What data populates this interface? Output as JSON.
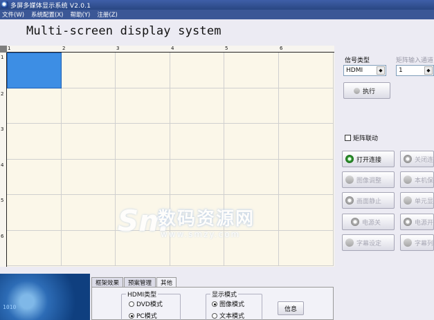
{
  "window": {
    "title": "多屏多媒体显示系统 V2.0.1"
  },
  "menu": [
    {
      "label": "文件(W)"
    },
    {
      "label": "系统配置(X)"
    },
    {
      "label": "帮助(Y)"
    },
    {
      "label": "注册(Z)"
    }
  ],
  "app_title": "Multi-screen display system",
  "grid": {
    "columns": [
      "1",
      "2",
      "3",
      "4",
      "5",
      "6"
    ],
    "rows": [
      "1",
      "2",
      "3",
      "4",
      "5",
      "6"
    ],
    "selected_cell": {
      "row": 1,
      "col": 1
    }
  },
  "signal": {
    "label": "信号类型",
    "value": "HDMI",
    "matrix_label": "矩阵输入通道",
    "matrix_value": "1",
    "execute_label": "执行"
  },
  "matrix_link": {
    "label": "矩阵联动",
    "checked": false
  },
  "buttons": {
    "open_conn": "打开连接",
    "close_conn": "关闭连",
    "image_adjust": "图像调整",
    "local_save": "本机保",
    "freeze": "画面静止",
    "unit_show": "单元显",
    "power_off": "电源关",
    "power_on": "电源开",
    "subtitle_set": "字幕设定",
    "subtitle_list": "字幕列"
  },
  "tabs": [
    {
      "label": "框架效果"
    },
    {
      "label": "预案管理"
    },
    {
      "label": "其他",
      "active": true
    }
  ],
  "hdmi_type": {
    "title": "HDMI类型",
    "options": [
      {
        "label": "DVD模式",
        "checked": false
      },
      {
        "label": "PC模式",
        "checked": true
      }
    ]
  },
  "display_mode": {
    "title": "显示模式",
    "options": [
      {
        "label": "图像模式",
        "checked": true
      },
      {
        "label": "文本模式",
        "checked": false
      }
    ]
  },
  "info_button": "信息",
  "watermark": {
    "text": "数码资源网",
    "url": "www.smzy.com",
    "logo": "Sm"
  },
  "banner_text": "1010",
  "icons": {
    "app": "app-icon",
    "execute": "play-icon",
    "open": "connect-icon",
    "close": "disconnect-icon"
  }
}
